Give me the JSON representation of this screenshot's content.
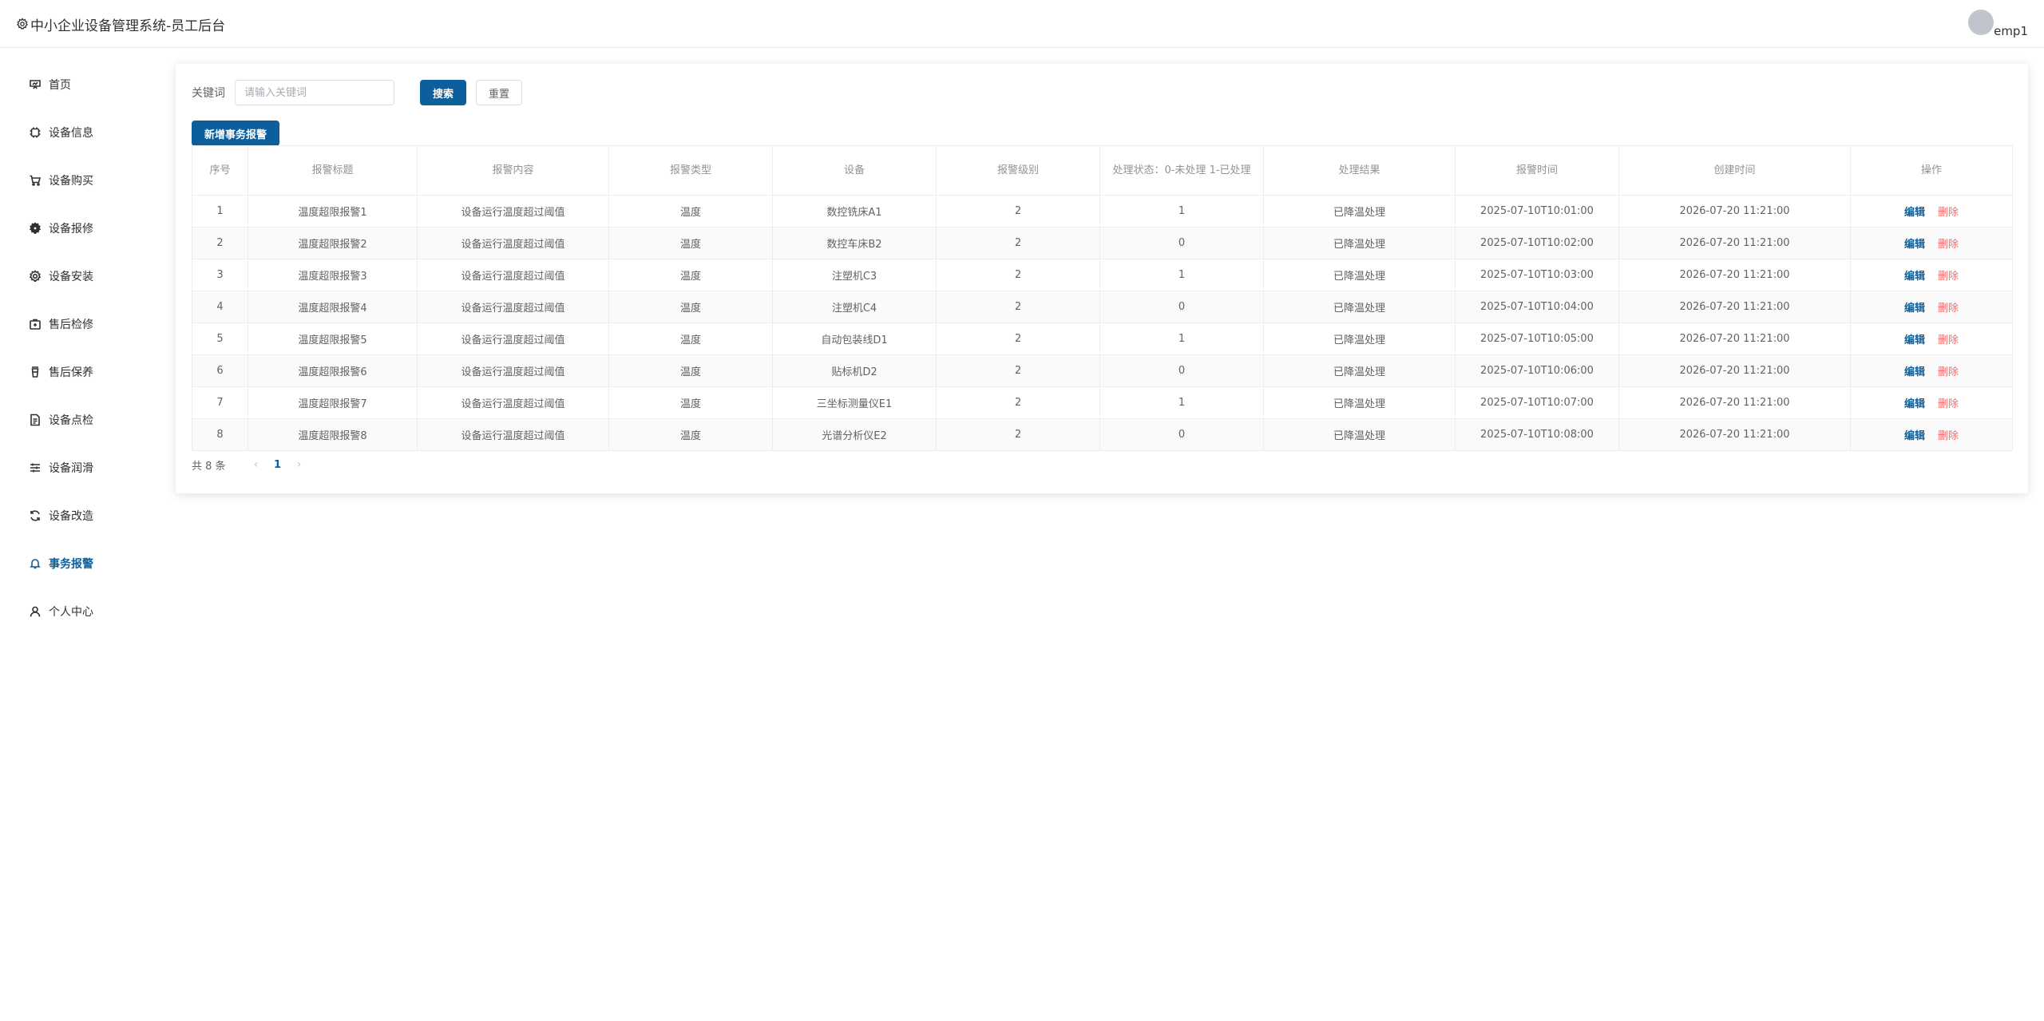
{
  "header": {
    "title": "中小企业设备管理系统-员工后台",
    "user_name": "emp1"
  },
  "sidebar": {
    "items": [
      {
        "label": "首页",
        "icon": "home-icon"
      },
      {
        "label": "设备信息",
        "icon": "cpu-icon"
      },
      {
        "label": "设备购买",
        "icon": "cart-icon"
      },
      {
        "label": "设备报修",
        "icon": "gear-filled-icon"
      },
      {
        "label": "设备安装",
        "icon": "gear-icon"
      },
      {
        "label": "售后检修",
        "icon": "first-aid-icon"
      },
      {
        "label": "售后保养",
        "icon": "cup-icon"
      },
      {
        "label": "设备点检",
        "icon": "document-icon"
      },
      {
        "label": "设备润滑",
        "icon": "sliders-icon"
      },
      {
        "label": "设备改造",
        "icon": "refresh-icon"
      },
      {
        "label": "事务报警",
        "icon": "bell-icon",
        "active": true
      },
      {
        "label": "个人中心",
        "icon": "user-icon"
      }
    ]
  },
  "search": {
    "label": "关键词",
    "placeholder": "请输入关键词",
    "search_label": "搜索",
    "reset_label": "重置"
  },
  "toolbar": {
    "add_label": "新增事务报警"
  },
  "table": {
    "columns": [
      "序号",
      "报警标题",
      "报警内容",
      "报警类型",
      "设备",
      "报警级别",
      "处理状态：0-未处理 1-已处理",
      "处理结果",
      "报警时间",
      "创建时间",
      "操作"
    ],
    "edit_label": "编辑",
    "delete_label": "删除",
    "rows": [
      [
        "1",
        "温度超限报警1",
        "设备运行温度超过阈值",
        "温度",
        "数控铣床A1",
        "2",
        "1",
        "已降温处理",
        "2025-07-10T10:01:00",
        "2026-07-20 11:21:00"
      ],
      [
        "2",
        "温度超限报警2",
        "设备运行温度超过阈值",
        "温度",
        "数控车床B2",
        "2",
        "0",
        "已降温处理",
        "2025-07-10T10:02:00",
        "2026-07-20 11:21:00"
      ],
      [
        "3",
        "温度超限报警3",
        "设备运行温度超过阈值",
        "温度",
        "注塑机C3",
        "2",
        "1",
        "已降温处理",
        "2025-07-10T10:03:00",
        "2026-07-20 11:21:00"
      ],
      [
        "4",
        "温度超限报警4",
        "设备运行温度超过阈值",
        "温度",
        "注塑机C4",
        "2",
        "0",
        "已降温处理",
        "2025-07-10T10:04:00",
        "2026-07-20 11:21:00"
      ],
      [
        "5",
        "温度超限报警5",
        "设备运行温度超过阈值",
        "温度",
        "自动包装线D1",
        "2",
        "1",
        "已降温处理",
        "2025-07-10T10:05:00",
        "2026-07-20 11:21:00"
      ],
      [
        "6",
        "温度超限报警6",
        "设备运行温度超过阈值",
        "温度",
        "贴标机D2",
        "2",
        "0",
        "已降温处理",
        "2025-07-10T10:06:00",
        "2026-07-20 11:21:00"
      ],
      [
        "7",
        "温度超限报警7",
        "设备运行温度超过阈值",
        "温度",
        "三坐标测量仪E1",
        "2",
        "1",
        "已降温处理",
        "2025-07-10T10:07:00",
        "2026-07-20 11:21:00"
      ],
      [
        "8",
        "温度超限报警8",
        "设备运行温度超过阈值",
        "温度",
        "光谱分析仪E2",
        "2",
        "0",
        "已降温处理",
        "2025-07-10T10:08:00",
        "2026-07-20 11:21:00"
      ]
    ]
  },
  "pagination": {
    "total_text": "共 8 条",
    "current_page": "1",
    "prev_icon": "chevron-left-icon",
    "next_icon": "chevron-right-icon"
  },
  "colors": {
    "accent": "#0c5f9c",
    "danger": "#f56c6c",
    "border": "#ebeef5"
  }
}
